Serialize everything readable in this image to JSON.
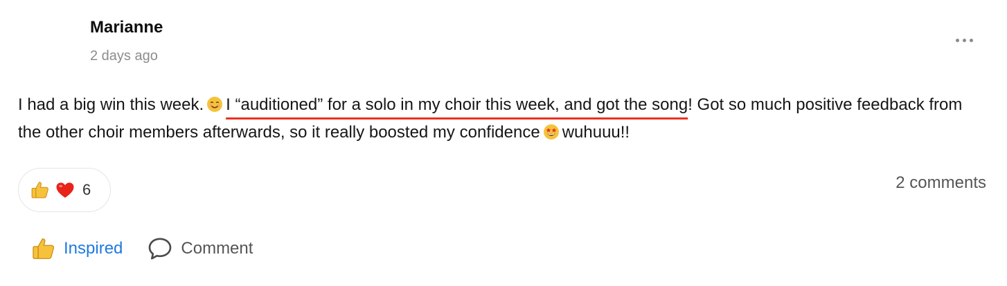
{
  "post": {
    "author": "Marianne",
    "timestamp": "2 days ago",
    "text_before": "I had a big win this week.",
    "text_highlighted": "I “auditioned” for a solo in my choir this week, and got the song",
    "text_after": "! Got so much positive feedback from the other choir members afterwards, so it really boosted my confidence",
    "text_end": "wuhuuu!!",
    "emoji_1": "smiling-face-icon",
    "emoji_2": "star-struck-face-icon",
    "highlight_color": "#e8311f"
  },
  "reactions": {
    "icons": [
      "thumbs-up-icon",
      "red-heart-icon"
    ],
    "count": "6"
  },
  "comments_count": "2 comments",
  "actions": {
    "inspired_label": "Inspired",
    "comment_label": "Comment",
    "inspired_color": "#1f7ae0"
  }
}
